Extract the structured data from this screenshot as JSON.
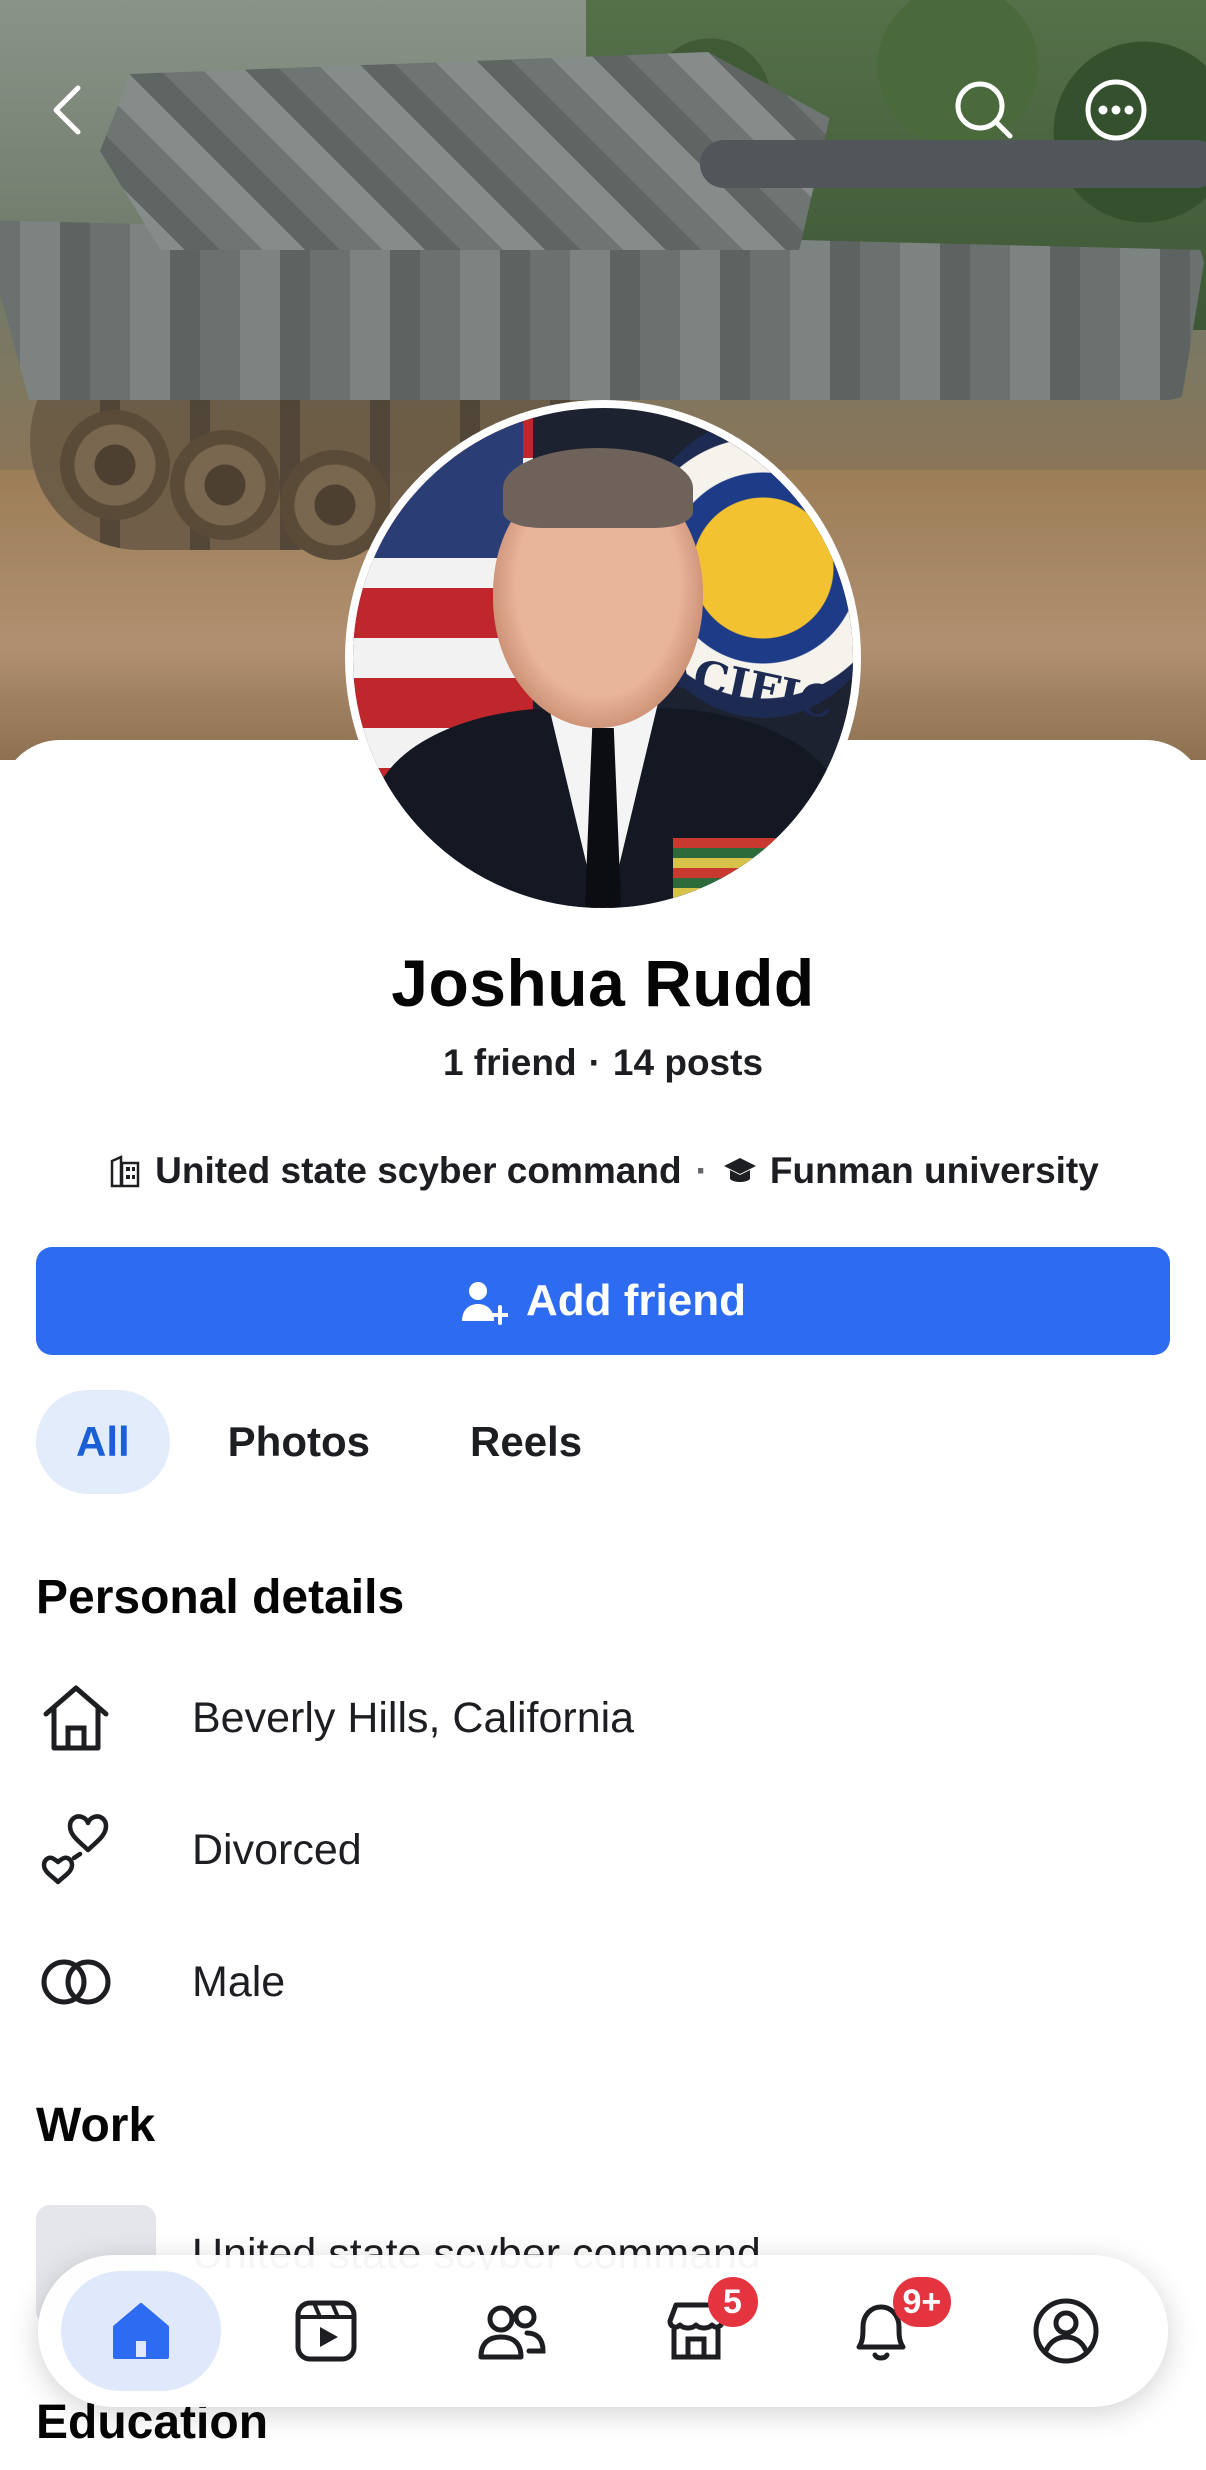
{
  "profile": {
    "name": "Joshua Rudd",
    "friends": "1 friend",
    "separator": "·",
    "posts": "14 posts",
    "work_short": "United state scyber command",
    "education_short": "Funman university",
    "meta_separator": "·"
  },
  "actions": {
    "add_friend_label": "Add friend"
  },
  "tabs": [
    {
      "label": "All",
      "active": true
    },
    {
      "label": "Photos",
      "active": false
    },
    {
      "label": "Reels",
      "active": false
    }
  ],
  "personal_details": {
    "title": "Personal details",
    "items": [
      {
        "icon": "home-icon",
        "text": "Beverly Hills, California"
      },
      {
        "icon": "hearts-icon",
        "text": "Divorced"
      },
      {
        "icon": "gender-icon",
        "text": "Male"
      }
    ]
  },
  "work": {
    "title": "Work",
    "entry": "United state scyber command"
  },
  "education": {
    "title": "Education"
  },
  "avatar_seal_text": "PACIFIC",
  "bottom_nav": [
    {
      "icon": "home-icon",
      "active": true
    },
    {
      "icon": "video-icon",
      "active": false
    },
    {
      "icon": "friends-icon",
      "active": false
    },
    {
      "icon": "marketplace-icon",
      "active": false,
      "badge": "5"
    },
    {
      "icon": "bell-icon",
      "active": false,
      "badge": "9+"
    },
    {
      "icon": "profile-icon",
      "active": false
    }
  ],
  "colors": {
    "accent": "#2d6bf0",
    "active_tab_bg": "#e3ecfb",
    "badge": "#e4343f"
  }
}
